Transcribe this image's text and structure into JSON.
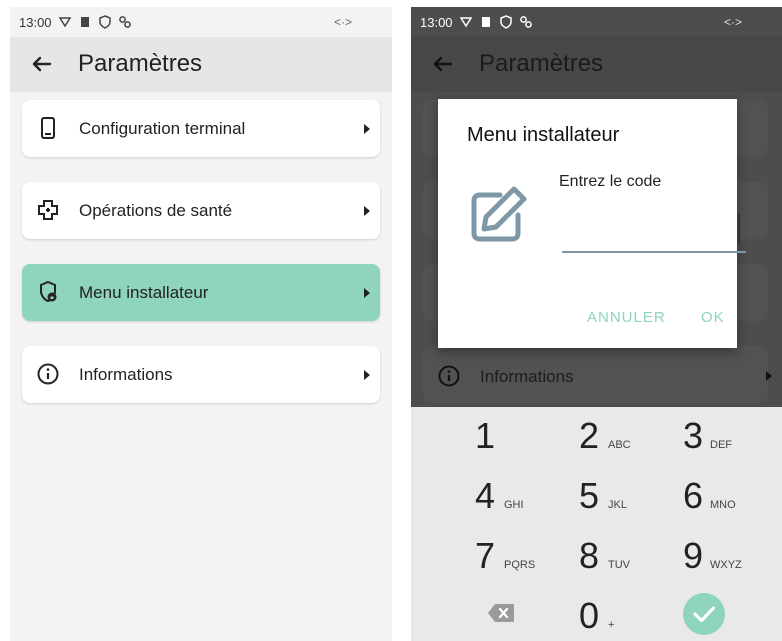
{
  "left": {
    "status": {
      "time": "13:00"
    },
    "appbar": {
      "title": "Paramètres"
    },
    "menu": [
      {
        "label": "Configuration terminal",
        "icon": "phone-device-icon"
      },
      {
        "label": "Opérations de santé",
        "icon": "medical-cross-icon"
      },
      {
        "label": "Menu installateur",
        "icon": "shield-lock-icon",
        "selected": true
      },
      {
        "label": "Informations",
        "icon": "info-icon"
      }
    ]
  },
  "right": {
    "status": {
      "time": "13:00"
    },
    "appbar": {
      "title": "Paramètres"
    },
    "background_item": {
      "label": "Informations"
    },
    "dialog": {
      "title": "Menu installateur",
      "prompt": "Entrez le code",
      "input_value": "",
      "cancel": "ANNULER",
      "ok": "OK",
      "icon": "edit-icon"
    },
    "keypad": {
      "keys": [
        {
          "num": "1",
          "sub": ""
        },
        {
          "num": "2",
          "sub": "ABC"
        },
        {
          "num": "3",
          "sub": "DEF"
        },
        {
          "num": "4",
          "sub": "GHI"
        },
        {
          "num": "5",
          "sub": "JKL"
        },
        {
          "num": "6",
          "sub": "MNO"
        },
        {
          "num": "7",
          "sub": "PQRS"
        },
        {
          "num": "8",
          "sub": "TUV"
        },
        {
          "num": "9",
          "sub": "WXYZ"
        },
        {
          "num": "0",
          "sub": "+"
        }
      ],
      "delete_icon": "backspace-icon",
      "confirm_icon": "check-icon"
    }
  },
  "colors": {
    "accent": "#8fd4bd",
    "scrim": "#4d4d4d",
    "card": "#ffffff",
    "link_gray": "#7f98a8"
  }
}
